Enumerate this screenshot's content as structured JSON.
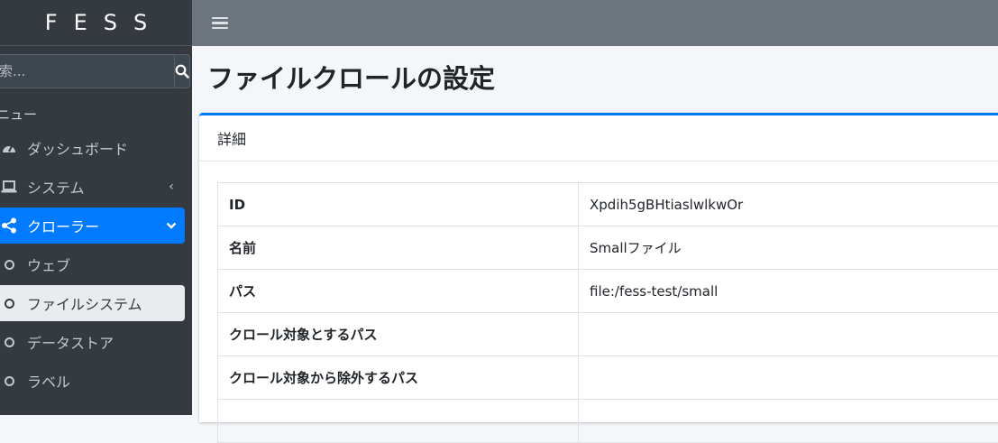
{
  "brand": "FESS",
  "search": {
    "placeholder": "索..."
  },
  "sidebar": {
    "menu_header": "ニュー",
    "items": [
      {
        "label": "ダッシュボード",
        "icon": "dashboard-gauge-icon"
      },
      {
        "label": "システム",
        "icon": "laptop-icon",
        "chevron": "‹"
      },
      {
        "label": "クローラー",
        "icon": "share-nodes-icon",
        "chevron": "⌄"
      },
      {
        "label": "ウェブ",
        "icon": "circle-icon"
      },
      {
        "label": "ファイルシステム",
        "icon": "circle-icon"
      },
      {
        "label": "データストア",
        "icon": "circle-icon"
      },
      {
        "label": "ラベル",
        "icon": "circle-icon"
      }
    ]
  },
  "page": {
    "title": "ファイルクロールの設定"
  },
  "card": {
    "header": "詳細"
  },
  "details": [
    {
      "key": "ID",
      "value": "Xpdih5gBHtiaslwlkwOr"
    },
    {
      "key": "名前",
      "value": "Smallファイル"
    },
    {
      "key": "パス",
      "value": "file:/fess-test/small"
    },
    {
      "key": "クロール対象とするパス",
      "value": ""
    },
    {
      "key": "クロール対象から除外するパス",
      "value": ""
    }
  ],
  "colors": {
    "sidebar_bg": "#343a40",
    "topbar_bg": "#6c757d",
    "accent": "#007bff",
    "selected_bg": "#e9ecef"
  }
}
